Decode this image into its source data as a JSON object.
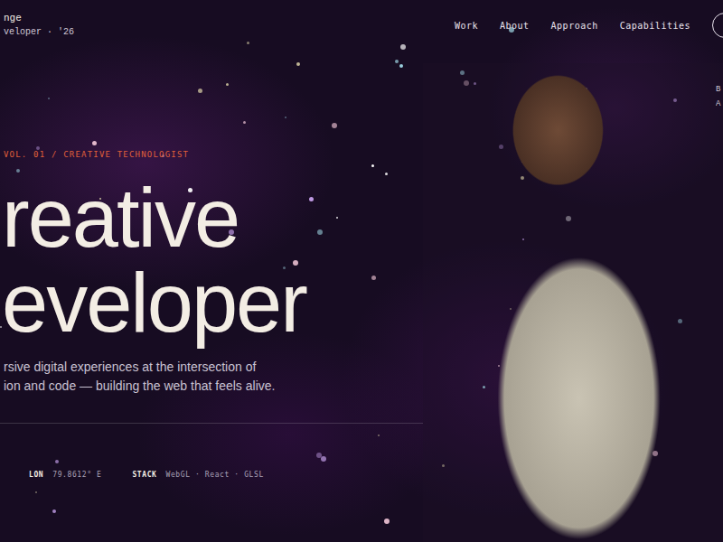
{
  "brand": {
    "name": "nge",
    "tagline": "veloper · '26"
  },
  "nav": [
    "Work",
    "About",
    "Approach",
    "Capabilities"
  ],
  "side_labels": [
    "B",
    "A"
  ],
  "hero": {
    "eyebrow": "VOL. 01 / CREATIVE TECHNOLOGIST",
    "title": [
      "reative",
      "eveloper"
    ],
    "lede": [
      "rsive digital experiences at the intersection of",
      "ion and code — building the web that feels alive."
    ]
  },
  "meta": [
    {
      "label": "LON",
      "value": "79.8612° E"
    },
    {
      "label": "STACK",
      "value": "WebGL · React · GLSL"
    }
  ]
}
